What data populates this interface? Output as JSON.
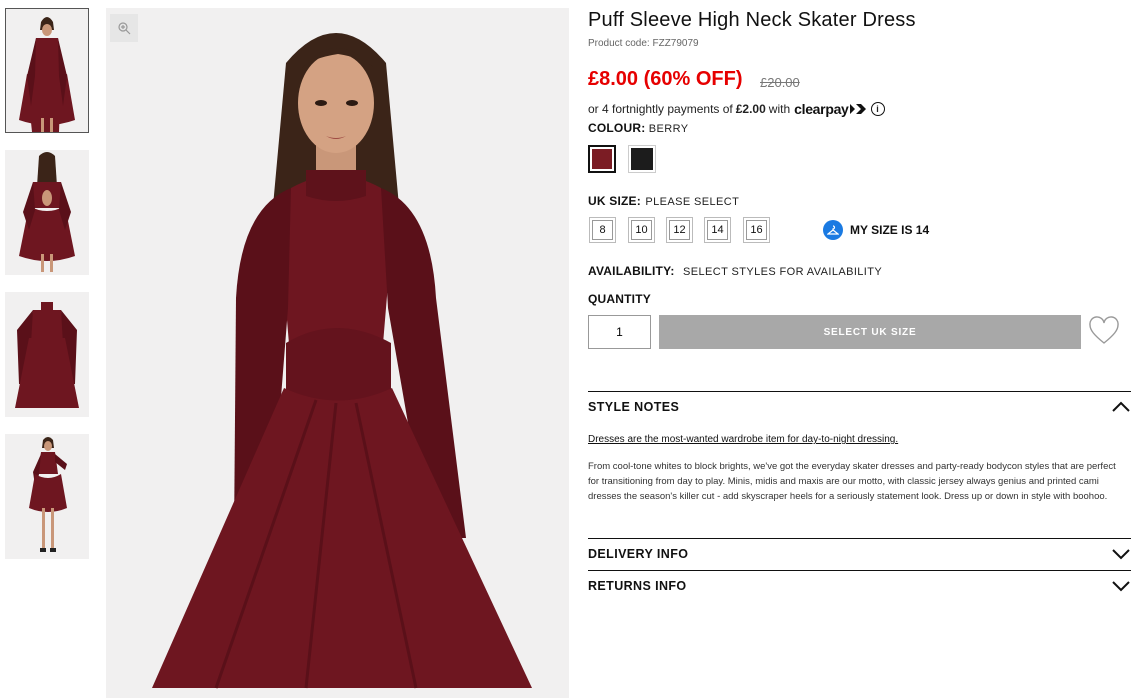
{
  "product": {
    "title": "Puff Sleeve High Neck Skater Dress",
    "product_code": "Product code: FZZ79079",
    "price": "£8.00 (60% OFF)",
    "was_price": "£20.00",
    "clearpay_prefix": "or 4 fortnightly payments of",
    "clearpay_amount": "£2.00",
    "clearpay_with": "with",
    "clearpay_logo": "clearpay",
    "info_glyph": "i"
  },
  "colour": {
    "label": "COLOUR:",
    "selected": "BERRY",
    "swatches": [
      {
        "name": "Berry",
        "color": "#7b1c24"
      },
      {
        "name": "Black",
        "color": "#1c1c1c"
      }
    ]
  },
  "size": {
    "label": "UK SIZE:",
    "prompt": "PLEASE SELECT",
    "options": [
      "8",
      "10",
      "12",
      "14",
      "16"
    ],
    "my_size": "MY SIZE IS 14"
  },
  "availability": {
    "label": "AVAILABILITY:",
    "value": "SELECT STYLES FOR AVAILABILITY"
  },
  "quantity": {
    "label": "QUANTITY",
    "value": "1",
    "add_button": "SELECT UK SIZE"
  },
  "accordion": {
    "style_notes": "STYLE NOTES",
    "notes_link": "Dresses are the most-wanted wardrobe item for day-to-night dressing.",
    "notes_body": "From cool-tone whites to block brights, we've got the everyday skater dresses and party-ready bodycon styles that are perfect for transitioning from day to play. Minis, midis and maxis are our motto, with classic jersey always genius and printed cami dresses the season's killer cut - add skyscraper heels for a seriously statement look. Dress up or down in style with boohoo.",
    "delivery": "DELIVERY INFO",
    "returns": "RETURNS INFO"
  },
  "colors": {
    "price_red": "#e60000",
    "dress": "#6e1620",
    "button_grey": "#a8a8a8",
    "mysize_blue": "#1a7ae2"
  },
  "icons": [
    "zoom-icon",
    "info-icon",
    "hanger-icon",
    "heart-icon",
    "chevron-up-icon",
    "chevron-down-icon"
  ]
}
